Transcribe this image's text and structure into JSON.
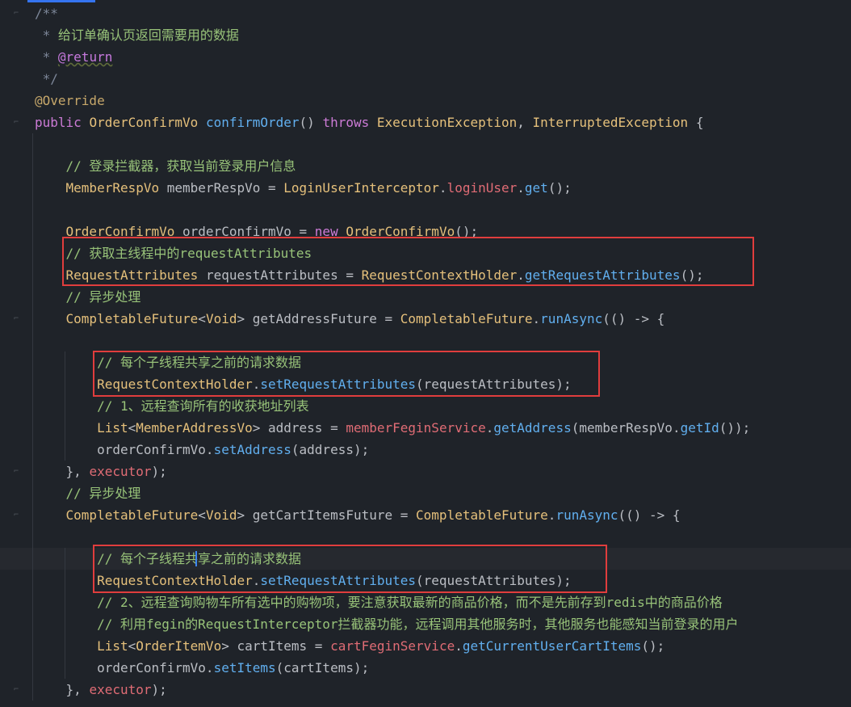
{
  "lines": [
    "/**",
    " * 给订单确认页返回需要用的数据",
    " * @return",
    " */",
    "@Override",
    "public OrderConfirmVo confirmOrder() throws ExecutionException, InterruptedException {",
    "",
    "    // 登录拦截器，获取当前登录用户信息",
    "    MemberRespVo memberRespVo = LoginUserInterceptor.loginUser.get();",
    "",
    "    OrderConfirmVo orderConfirmVo = new OrderConfirmVo();",
    "    // 获取主线程中的requestAttributes",
    "    RequestAttributes requestAttributes = RequestContextHolder.getRequestAttributes();",
    "    // 异步处理",
    "    CompletableFuture<Void> getAddressFuture = CompletableFuture.runAsync(() -> {",
    "",
    "        // 每个子线程共享之前的请求数据",
    "        RequestContextHolder.setRequestAttributes(requestAttributes);",
    "        // 1、远程查询所有的收获地址列表",
    "        List<MemberAddressVo> address = memberFeginService.getAddress(memberRespVo.getId());",
    "        orderConfirmVo.setAddress(address);",
    "    }, executor);",
    "    // 异步处理",
    "    CompletableFuture<Void> getCartItemsFuture = CompletableFuture.runAsync(() -> {",
    "",
    "        // 每个子线程共享之前的请求数据",
    "        RequestContextHolder.setRequestAttributes(requestAttributes);",
    "        // 2、远程查询购物车所有选中的购物项，要注意获取最新的商品价格，而不是先前存到redis中的商品价格",
    "        // 利用fegin的RequestInterceptor拦截器功能，远程调用其他服务时，其他服务也能感知当前登录的用户",
    "        List<OrderItemVo> cartItems = cartFeginService.getCurrentUserCartItems();",
    "        orderConfirmVo.setItems(cartItems);",
    "    }, executor);"
  ],
  "tokens": {
    "kw": [
      "public",
      "throws",
      "new"
    ],
    "types": [
      "OrderConfirmVo",
      "ExecutionException",
      "InterruptedException",
      "MemberRespVo",
      "LoginUserInterceptor",
      "RequestAttributes",
      "RequestContextHolder",
      "CompletableFuture",
      "Void",
      "List",
      "MemberAddressVo",
      "OrderItemVo"
    ],
    "fields": [
      "loginUser",
      "memberFeginService",
      "cartFeginService",
      "executor"
    ],
    "fns": [
      "confirmOrder",
      "get",
      "getRequestAttributes",
      "runAsync",
      "setRequestAttributes",
      "getAddress",
      "getId",
      "setAddress",
      "getCurrentUserCartItems",
      "setItems"
    ]
  },
  "colors": {
    "background": "#1f2329",
    "comment": "#7d8799",
    "chinese_comment": "#98c379",
    "keyword": "#cc7bd6",
    "type": "#e5c07b",
    "function": "#61afef",
    "field": "#e06c75",
    "annotation": "#c6a76a",
    "highlight_box": "#e03d3d"
  }
}
